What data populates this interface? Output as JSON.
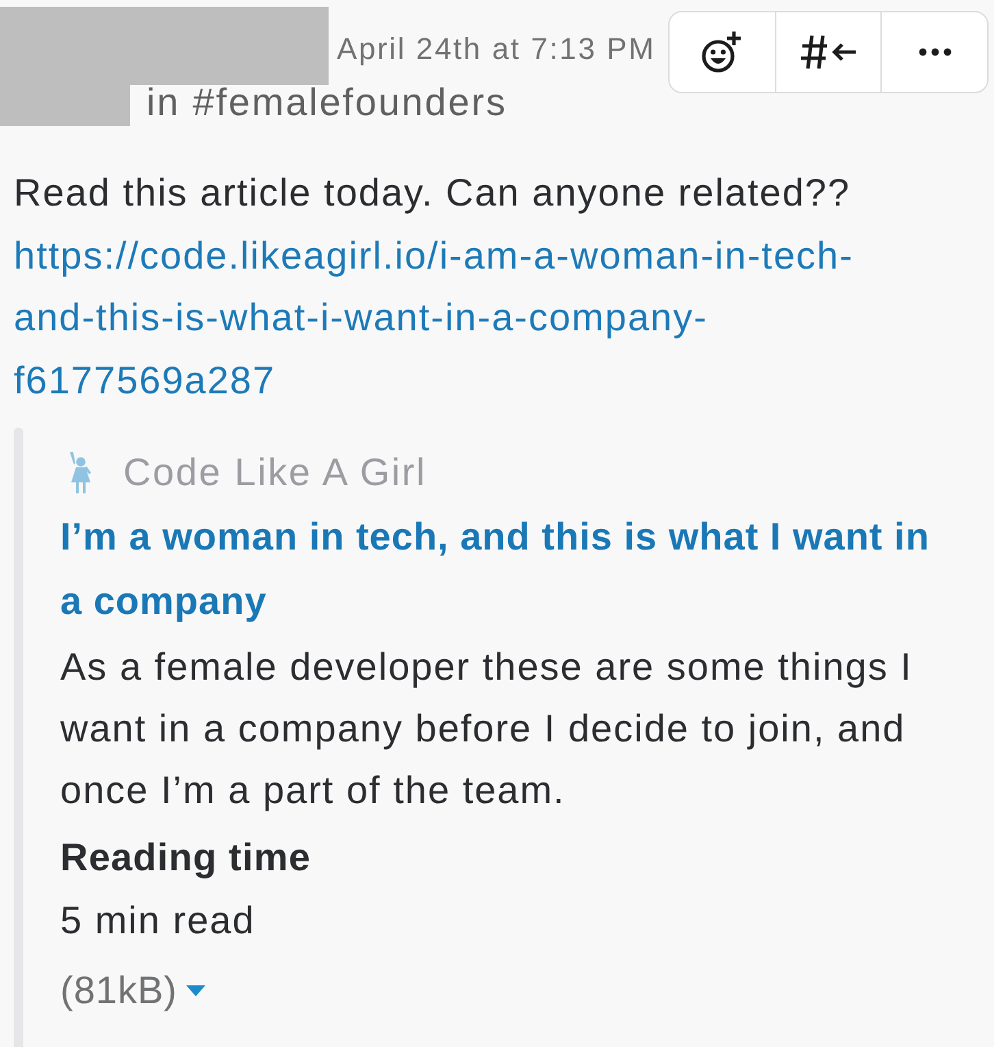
{
  "message_header": {
    "timestamp": "April 24th at 7:13 PM",
    "channel": "in #femalefounders"
  },
  "toolbar": [
    {
      "kind": "reaction"
    },
    {
      "kind": "share"
    },
    {
      "kind": "more"
    }
  ],
  "message": {
    "text": "Read this article today. Can anyone related??",
    "link": "https://code.likeagirl.io/i-am-a-woman-in-tech-and-this-is-what-i-want-in-a-company-f6177569a287"
  },
  "attachment": {
    "service_name": "Code Like A Girl",
    "title": "I’m a woman in tech, and this is what I want in a company",
    "description": "As a female developer these are some things I want in a company before I decide to join, and once I’m a part of the team.",
    "fields": [
      {
        "title": "Reading time",
        "value": "5 min read"
      }
    ],
    "file_size": "(81kB)",
    "expanded": true
  }
}
